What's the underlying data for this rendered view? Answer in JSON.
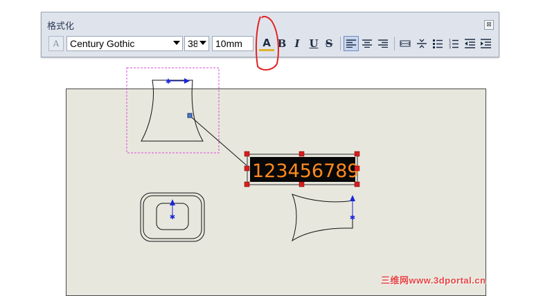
{
  "toolbar": {
    "title": "格式化",
    "close_glyph": "⊠",
    "text_style_glyph": "A",
    "font_name": "Century Gothic",
    "font_size": "38",
    "height_value": "10mm",
    "buttons": {
      "font_color": "A",
      "bold": "B",
      "italic": "I",
      "underline": "U",
      "strikethrough": "S"
    }
  },
  "note": {
    "text": "123456789"
  },
  "watermark": {
    "text": "三维网www.3dportal.cn"
  },
  "colors": {
    "note_text": "#ff8a1e",
    "handle": "#d81e1e",
    "selection_box": "#d94ad9",
    "arrow": "#1a24d8",
    "annotation": "#e22222"
  }
}
